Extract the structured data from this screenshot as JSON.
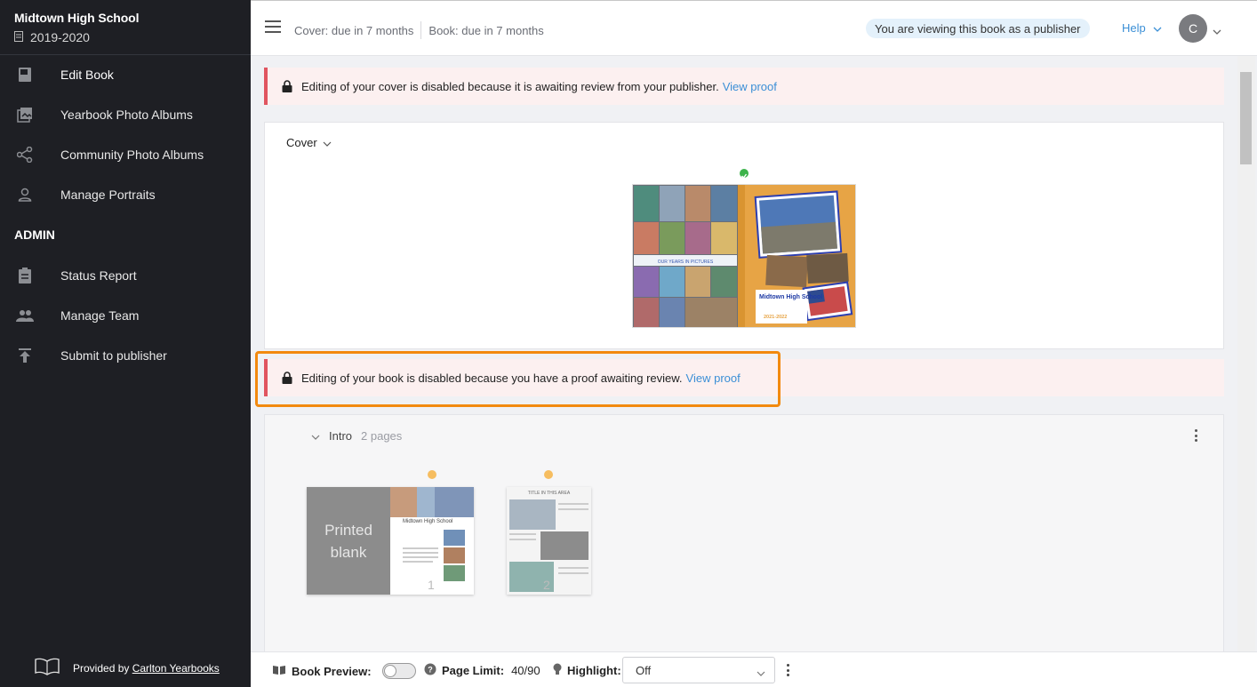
{
  "sidebar": {
    "school_name": "Midtown High School",
    "school_year": "2019-2020",
    "items": [
      {
        "label": "Edit Book",
        "icon": "book-icon"
      },
      {
        "label": "Yearbook Photo Albums",
        "icon": "photo-album-icon"
      },
      {
        "label": "Community Photo Albums",
        "icon": "share-icon"
      },
      {
        "label": "Manage Portraits",
        "icon": "person-icon"
      }
    ],
    "admin_heading": "ADMIN",
    "admin_items": [
      {
        "label": "Status Report",
        "icon": "clipboard-icon"
      },
      {
        "label": "Manage Team",
        "icon": "team-icon"
      },
      {
        "label": "Submit to publisher",
        "icon": "upload-icon"
      }
    ],
    "provided_by_prefix": "Provided by",
    "provided_by_link": "Carlton Yearbooks"
  },
  "header": {
    "cover_due": "Cover: due in 7 months",
    "book_due": "Book: due in 7 months",
    "viewer_notice": "You are viewing this book as a publisher",
    "help_label": "Help",
    "avatar_initial": "C"
  },
  "alerts": {
    "cover_text": "Editing of your cover is disabled because it is awaiting review from your publisher.",
    "cover_link": "View proof",
    "book_text": "Editing of your book is disabled because you have a proof awaiting review.",
    "book_link": "View proof"
  },
  "cover_section": {
    "label": "Cover",
    "cover_caption": "OUR YEARS IN PICTURES",
    "cover_title": "Midtown High School",
    "cover_year": "2021-2022"
  },
  "intro_section": {
    "label": "Intro",
    "count": "2 pages",
    "pages": [
      {
        "blank_text": "Printed blank",
        "title": "Midtown High School",
        "number": "1"
      },
      {
        "title": "TITLE IN THIS AREA",
        "number": "2"
      }
    ]
  },
  "bottom_bar": {
    "book_preview_label": "Book Preview:",
    "page_limit_label": "Page Limit:",
    "page_limit_value": "40/90",
    "highlight_label": "Highlight:",
    "highlight_value": "Off"
  },
  "colors": {
    "sidebar_bg": "#1e1f24",
    "accent": "#3b8fd6",
    "alert_border": "#e05560",
    "highlight_box": "#f28a0f"
  }
}
